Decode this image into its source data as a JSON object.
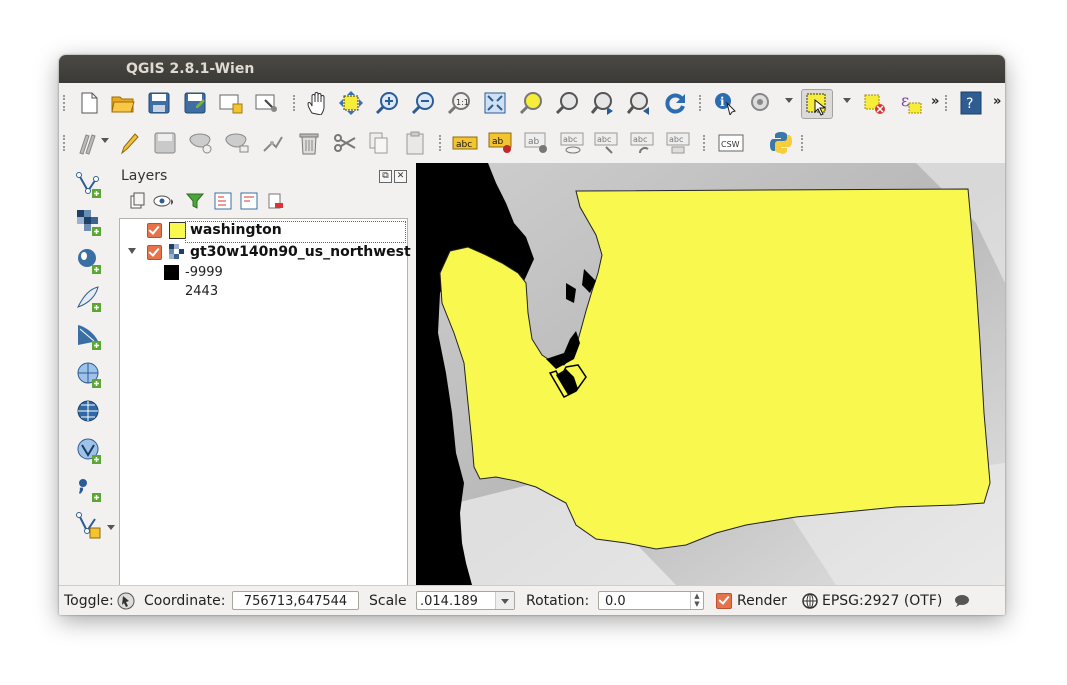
{
  "window": {
    "title": "QGIS 2.8.1-Wien"
  },
  "layers_panel": {
    "title": "Layers",
    "layers": [
      {
        "name": "washington",
        "checked": true,
        "swatch_color": "#f8f84e"
      },
      {
        "name": "gt30w140n90_us_northwest",
        "checked": true,
        "expanded": true,
        "legend": [
          {
            "label": "-9999",
            "color": "#000000"
          },
          {
            "label": "2443",
            "color": "#ffffff"
          }
        ]
      }
    ]
  },
  "toolbar": {
    "overflow_label": "»"
  },
  "statusbar": {
    "toggle_label": "Toggle:",
    "coordinate_label": "Coordinate:",
    "coordinate_value": "756713,647544",
    "scale_label": "Scale",
    "scale_value": ".014.189",
    "rotation_label": "Rotation:",
    "rotation_value": "0.0",
    "render_label": "Render",
    "render_checked": true,
    "crs_label": "EPSG:2927 (OTF)"
  },
  "colors": {
    "polygon_fill": "#f8f84e",
    "checkbox": "#e8734a",
    "titlebar": "#3c3b37"
  },
  "icons": {
    "top_row_1": [
      "new-project-icon",
      "open-project-icon",
      "save-project-icon",
      "save-as-icon",
      "new-print-composer-icon",
      "composer-manager-icon",
      "pan-icon",
      "pan-to-selection-icon",
      "zoom-in-icon",
      "zoom-out-icon",
      "zoom-native-icon",
      "zoom-full-icon",
      "zoom-to-selection-icon",
      "zoom-to-layer-icon",
      "zoom-last-icon",
      "zoom-next-icon",
      "refresh-icon",
      "identify-icon",
      "action-icon",
      "select-feature-icon",
      "deselect-icon",
      "expression-select-icon",
      "help-icon"
    ],
    "top_row_2": [
      "digitize-icon",
      "toggle-edit-icon",
      "save-edits-icon",
      "add-feature-icon",
      "move-feature-icon",
      "node-tool-icon",
      "delete-selected-icon",
      "cut-icon",
      "copy-icon",
      "paste-icon",
      "label-icon",
      "pin-label-icon",
      "highlight-label-icon",
      "show-hide-label-icon",
      "move-label-icon",
      "rotate-label-icon",
      "change-label-icon",
      "csw-icon",
      "python-icon"
    ],
    "left": [
      "add-vector-layer-icon",
      "add-raster-layer-icon",
      "add-postgis-layer-icon",
      "add-spatialite-layer-icon",
      "add-mssql-layer-icon",
      "add-wms-layer-icon",
      "add-wcs-layer-icon",
      "add-wfs-layer-icon",
      "add-delimited-text-icon",
      "new-shapefile-icon"
    ]
  }
}
